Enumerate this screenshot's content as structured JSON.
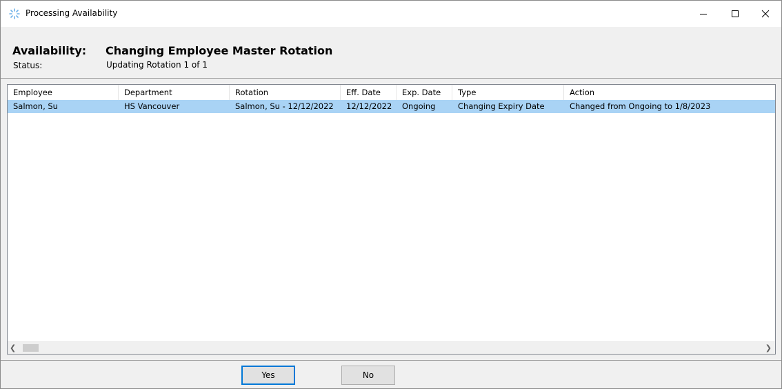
{
  "window": {
    "title": "Processing Availability",
    "icon": "spinner-icon"
  },
  "header": {
    "availability_label": "Availability:",
    "availability_value": "Changing Employee Master Rotation",
    "status_label": "Status:",
    "status_value": "Updating Rotation 1 of 1"
  },
  "table": {
    "columns": [
      "Employee",
      "Department",
      "Rotation",
      "Eff. Date",
      "Exp. Date",
      "Type",
      "Action"
    ],
    "rows": [
      {
        "employee": "Salmon, Su",
        "department": "HS Vancouver",
        "rotation": "Salmon, Su - 12/12/2022",
        "eff_date": "12/12/2022",
        "exp_date": "Ongoing",
        "type": "Changing Expiry Date",
        "action": "Changed from Ongoing to 1/8/2023",
        "selected": true
      }
    ]
  },
  "buttons": {
    "yes": "Yes",
    "no": "No"
  },
  "colors": {
    "selection": "#a9d3f5",
    "focus_border": "#0078d7"
  }
}
